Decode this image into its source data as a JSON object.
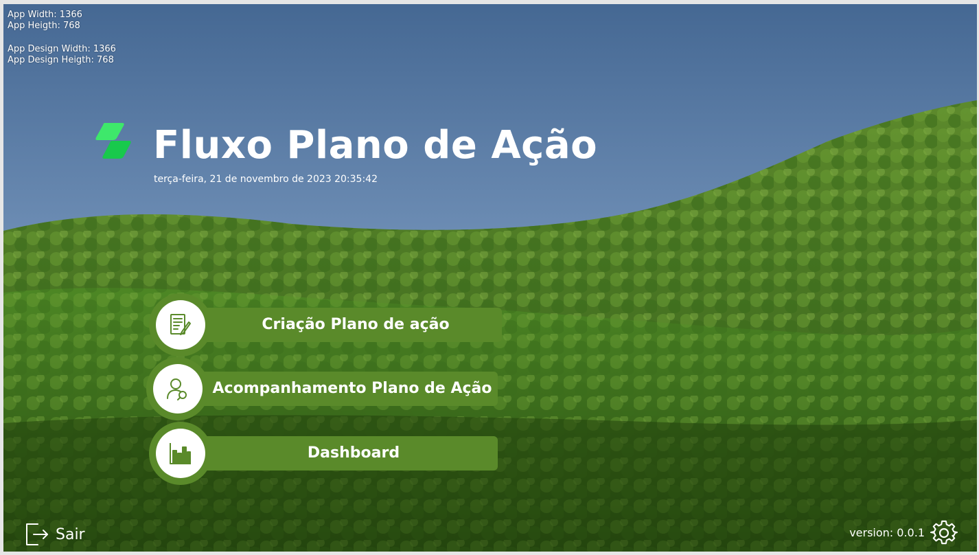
{
  "debug": {
    "app_width": "App Width: 1366",
    "app_height": "App Heigth: 768",
    "design_width": "App Design Width: 1366",
    "design_height": "App Design Heigth: 768"
  },
  "header": {
    "title": "Fluxo Plano de Ação",
    "datetime": "terça-feira, 21 de novembro de 2023 20:35:42",
    "logo_icon": "green-stacked-layers-logo"
  },
  "menu": [
    {
      "label": "Criação Plano de ação",
      "icon": "document-edit-icon"
    },
    {
      "label": "Acompanhamento Plano de Ação",
      "icon": "user-search-icon"
    },
    {
      "label": "Dashboard",
      "icon": "bar-chart-icon"
    }
  ],
  "footer": {
    "exit_label": "Sair",
    "exit_icon": "exit-icon",
    "version": "version: 0.0.1",
    "settings_icon": "gear-icon"
  },
  "colors": {
    "button_green": "#5a8a2a",
    "logo_green": "#22dd55",
    "sky": "#486e9c",
    "forest": "#3f6e1f"
  }
}
